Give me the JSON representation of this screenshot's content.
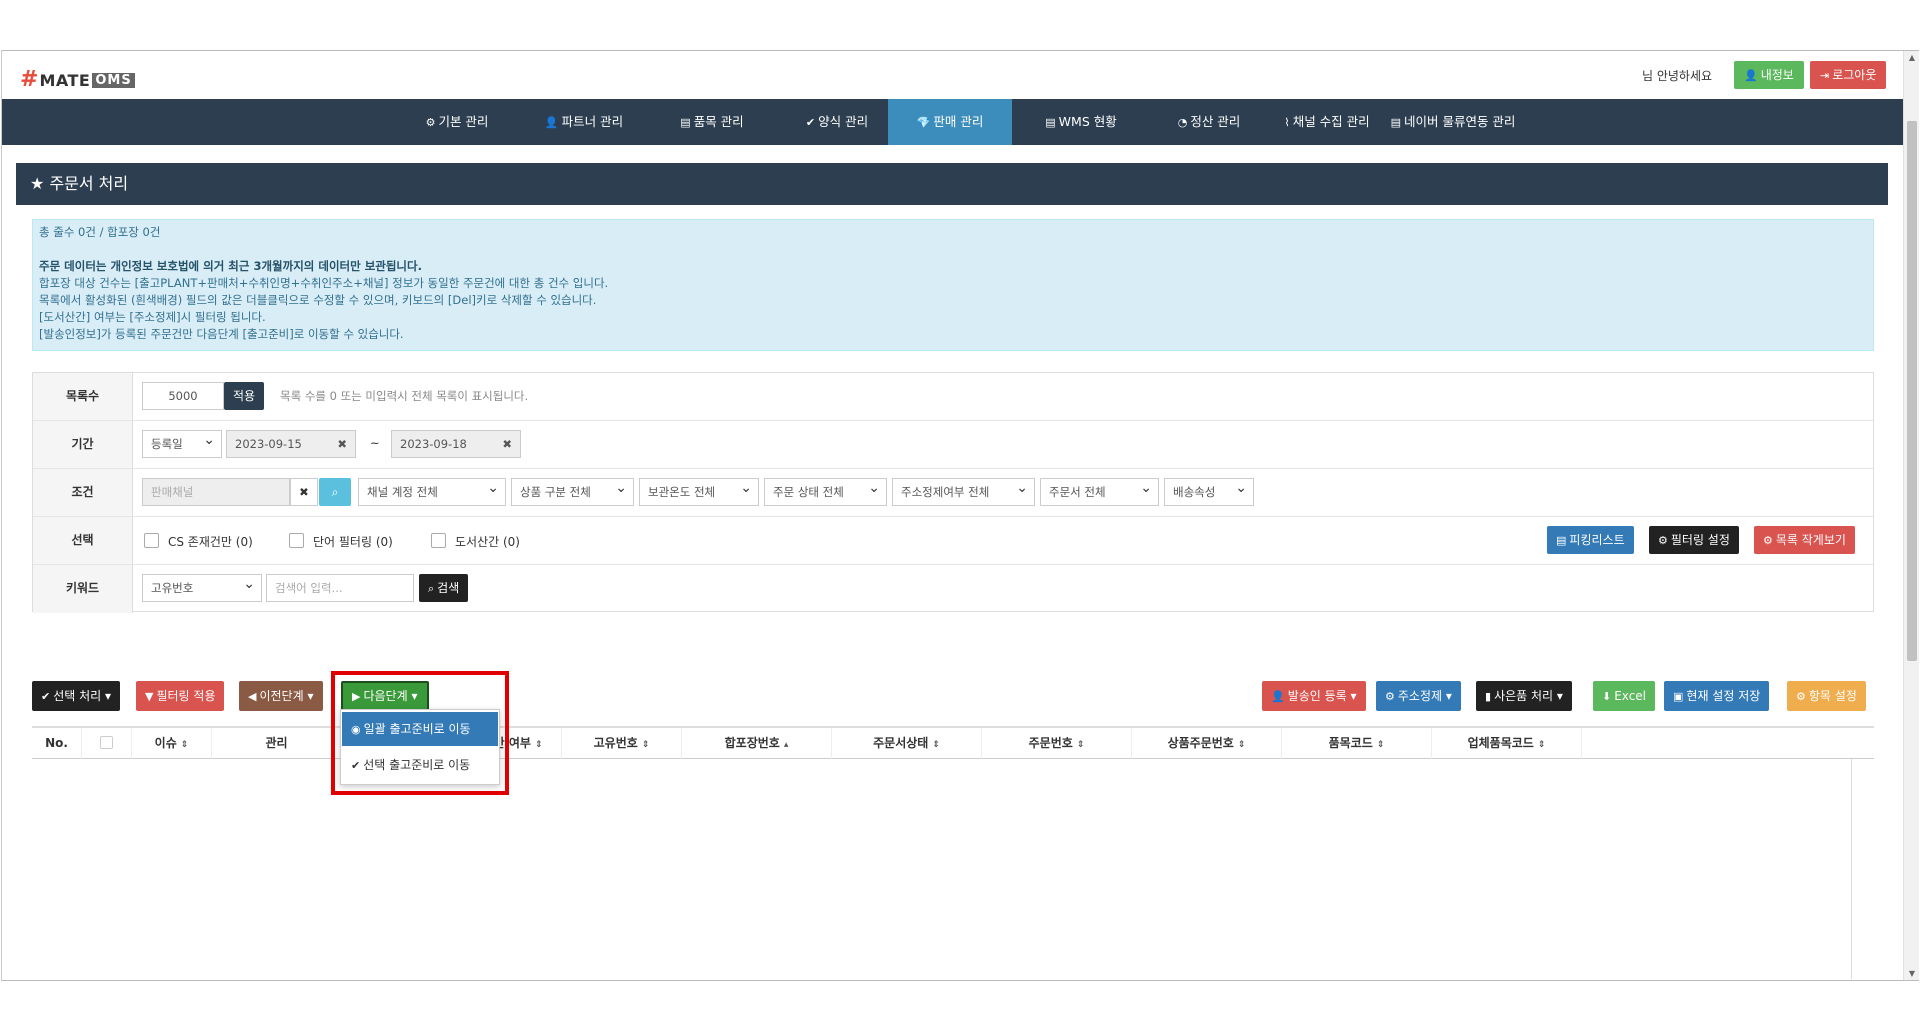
{
  "header": {
    "logo_hash": "#",
    "logo_mate": "MATE",
    "logo_oms": "OMS",
    "greeting": "님 안녕하세요",
    "my_info": "내정보",
    "logout": "로그아웃"
  },
  "nav": [
    {
      "label": "기본 관리",
      "icon": "⚙"
    },
    {
      "label": "파트너 관리",
      "icon": "👤"
    },
    {
      "label": "품목 관리",
      "icon": "▤"
    },
    {
      "label": "양식 관리",
      "icon": "✔"
    },
    {
      "label": "판매 관리",
      "icon": "💎"
    },
    {
      "label": "WMS 현황",
      "icon": "▤"
    },
    {
      "label": "정산 관리",
      "icon": "◔"
    },
    {
      "label": "채널 수집 관리",
      "icon": "⌇"
    },
    {
      "label": "네이버 물류연동 관리",
      "icon": "▤"
    }
  ],
  "page": {
    "title": "주문서 처리",
    "title_icon": "★"
  },
  "info": {
    "line1": "총 줄수 0건 / 합포장 0건",
    "line2": "주문 데이터는 개인정보 보호법에 의거 최근 3개월까지의 데이터만 보관됩니다.",
    "line3": "합포장 대상 건수는 [출고PLANT+판매처+수취인명+수취인주소+채널] 정보가 동일한 주문건에 대한 총 건수 입니다.",
    "line4": "목록에서 활성화된 (흰색배경) 필드의 값은 더블클릭으로 수정할 수 있으며, 키보드의 [Del]키로 삭제할 수 있습니다.",
    "line5": "[도서산간] 여부는 [주소정제]시 필터링 됩니다.",
    "line6": "[발송인정보]가 등록된 주문건만 다음단계 [출고준비]로 이동할 수 있습니다."
  },
  "filters": {
    "row_count_label": "목록수",
    "row_count_value": "5000",
    "apply": "적용",
    "row_count_hint": "목록 수를 0 또는 미입력시 전체 목록이 표시됩니다.",
    "period_label": "기간",
    "date_type": "등록일",
    "date_from": "2023-09-15",
    "tilde": "~",
    "date_to": "2023-09-18",
    "condition_label": "조건",
    "channel_placeholder": "판매채널",
    "selects": [
      "채널 계정 전체",
      "상품 구분 전체",
      "보관온도 전체",
      "주문 상태 전체",
      "주소정제여부 전체",
      "주문서 전체",
      "배송속성"
    ],
    "select_label": "선택",
    "checks": [
      "CS 존재건만 (0)",
      "단어 필터링 (0)",
      "도서산간 (0)"
    ],
    "picking_list": "피킹리스트",
    "filter_settings": "필터링 설정",
    "list_small": "목록 작게보기",
    "keyword_label": "키워드",
    "keyword_type": "고유번호",
    "keyword_placeholder": "검색어 입력...",
    "search": "검색"
  },
  "actions": {
    "select_process": "선택 처리",
    "filter_apply": "필터링 적용",
    "prev_step": "이전단계",
    "next_step": "다음단계",
    "sender_reg": "발송인 등록",
    "addr_clean": "주소정제",
    "gift_process": "사은품 처리",
    "excel": "Excel",
    "save_settings": "현재 설정 저장",
    "item_settings": "항목 설정"
  },
  "dropdown": {
    "opt1": "일괄 출고준비로 이동",
    "opt2": "선택 출고준비로 이동"
  },
  "table": {
    "headers": [
      "No.",
      "이슈",
      "관리",
      "도서산간 여부",
      "고유번호",
      "합포장번호",
      "주문서상태",
      "주문번호",
      "상품주문번호",
      "품목코드",
      "업체품목코드"
    ]
  },
  "colors": {
    "navbar": "#2c3e50",
    "nav_active": "#3c8dbc",
    "green": "#5cb85c",
    "red": "#d9534f",
    "blue": "#337ab7",
    "orange": "#f0ad4e",
    "brown": "#8a5a44"
  }
}
